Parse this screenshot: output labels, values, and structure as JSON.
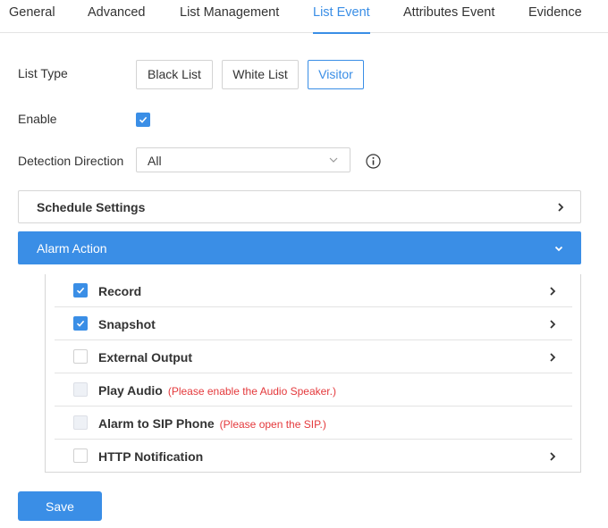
{
  "tabs": [
    {
      "label": "General",
      "active": false
    },
    {
      "label": "Advanced",
      "active": false
    },
    {
      "label": "List Management",
      "active": false
    },
    {
      "label": "List Event",
      "active": true
    },
    {
      "label": "Attributes Event",
      "active": false
    },
    {
      "label": "Evidence",
      "active": false
    }
  ],
  "list_type": {
    "label": "List Type",
    "options": [
      "Black List",
      "White List",
      "Visitor"
    ],
    "selected": "Visitor"
  },
  "enable": {
    "label": "Enable",
    "checked": true
  },
  "detection_direction": {
    "label": "Detection Direction",
    "value": "All"
  },
  "schedule_settings": {
    "title": "Schedule Settings",
    "expanded": false
  },
  "alarm_action": {
    "title": "Alarm Action",
    "expanded": true,
    "items": [
      {
        "label": "Record",
        "checked": true,
        "disabled": false,
        "note": "",
        "has_arrow": true
      },
      {
        "label": "Snapshot",
        "checked": true,
        "disabled": false,
        "note": "",
        "has_arrow": true
      },
      {
        "label": "External Output",
        "checked": false,
        "disabled": false,
        "note": "",
        "has_arrow": true
      },
      {
        "label": "Play Audio",
        "checked": false,
        "disabled": true,
        "note": "(Please enable the Audio Speaker.)",
        "has_arrow": false
      },
      {
        "label": "Alarm to SIP Phone",
        "checked": false,
        "disabled": true,
        "note": "(Please open the SIP.)",
        "has_arrow": false
      },
      {
        "label": "HTTP Notification",
        "checked": false,
        "disabled": false,
        "note": "",
        "has_arrow": true
      }
    ]
  },
  "save_label": "Save",
  "colors": {
    "accent": "#3a8ee6",
    "warning": "#e4393c"
  }
}
